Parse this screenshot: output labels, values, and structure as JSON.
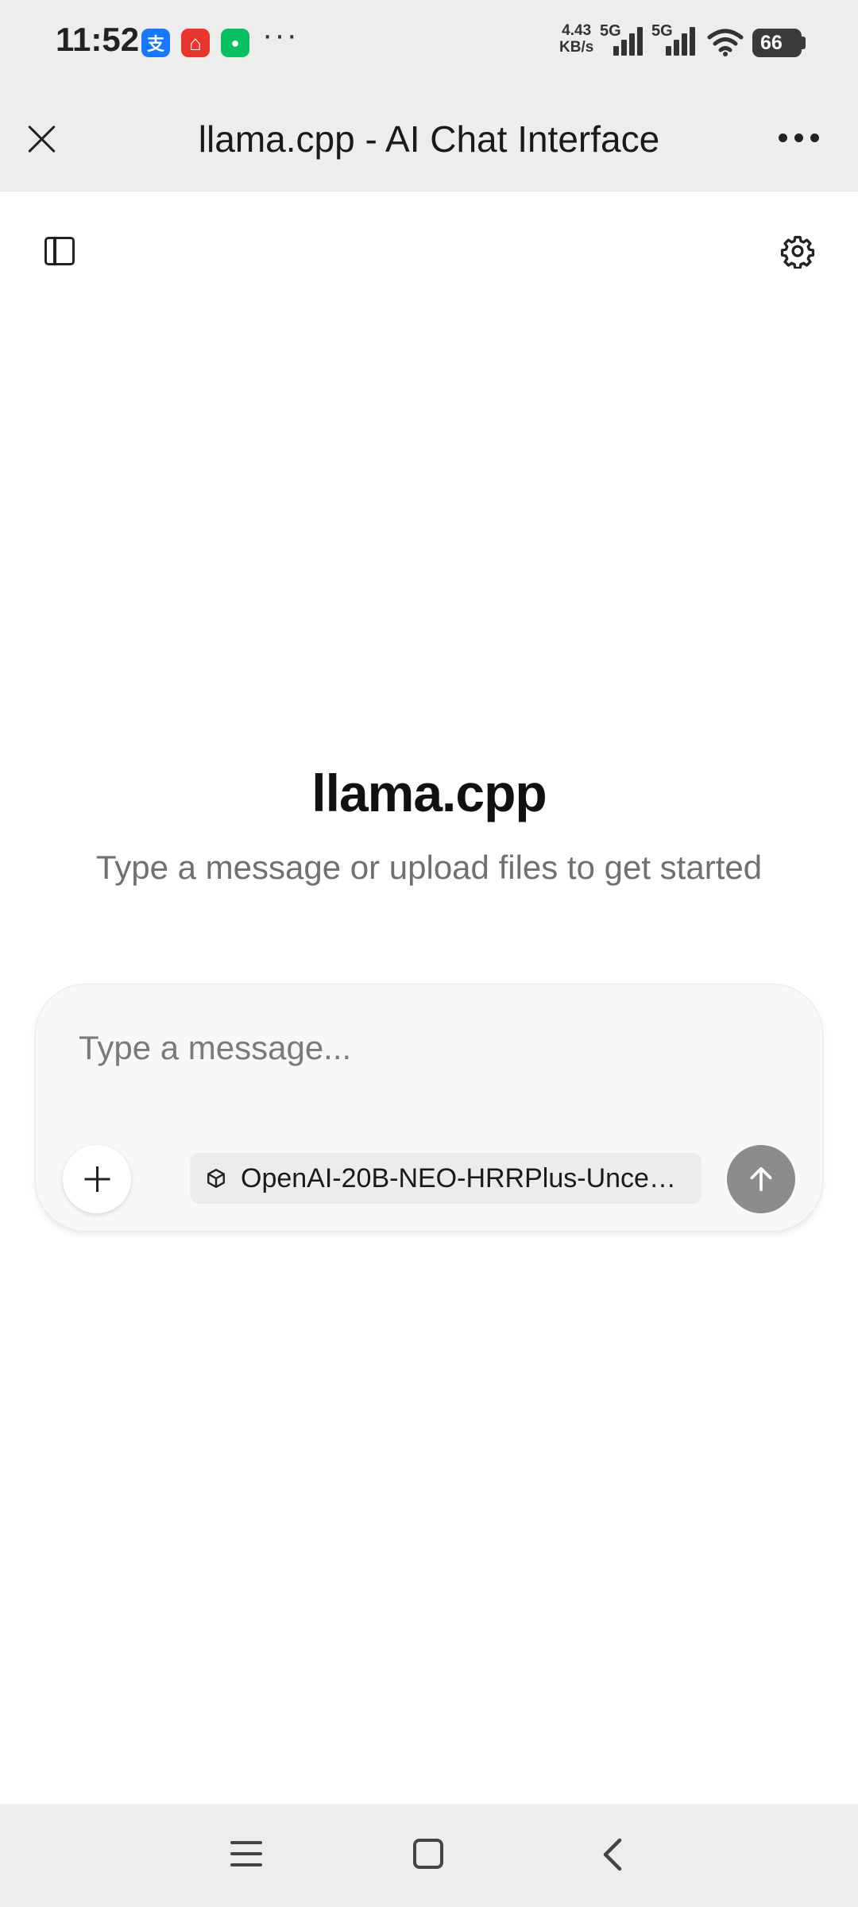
{
  "status_bar": {
    "time": "11:52",
    "app_icons": [
      {
        "icon": "alipay-icon",
        "glyph": "支",
        "color": "#1677ff"
      },
      {
        "icon": "home-app-icon",
        "glyph": "⌂",
        "color": "#e8362c"
      },
      {
        "icon": "wechat-icon",
        "glyph": "●",
        "color": "#07c160"
      }
    ],
    "more": "···",
    "net_speed_value": "4.43",
    "net_speed_unit": "KB/s",
    "signal_1_label": "5G",
    "signal_2_label": "5G",
    "battery": "66"
  },
  "browser": {
    "title": "llama.cpp - AI Chat Interface"
  },
  "welcome": {
    "title": "llama.cpp",
    "subtitle": "Type a message or upload files to get started"
  },
  "composer": {
    "placeholder": "Type a message...",
    "model_name": "OpenAI-20B-NEO-HRRPlus-Uncen..."
  }
}
